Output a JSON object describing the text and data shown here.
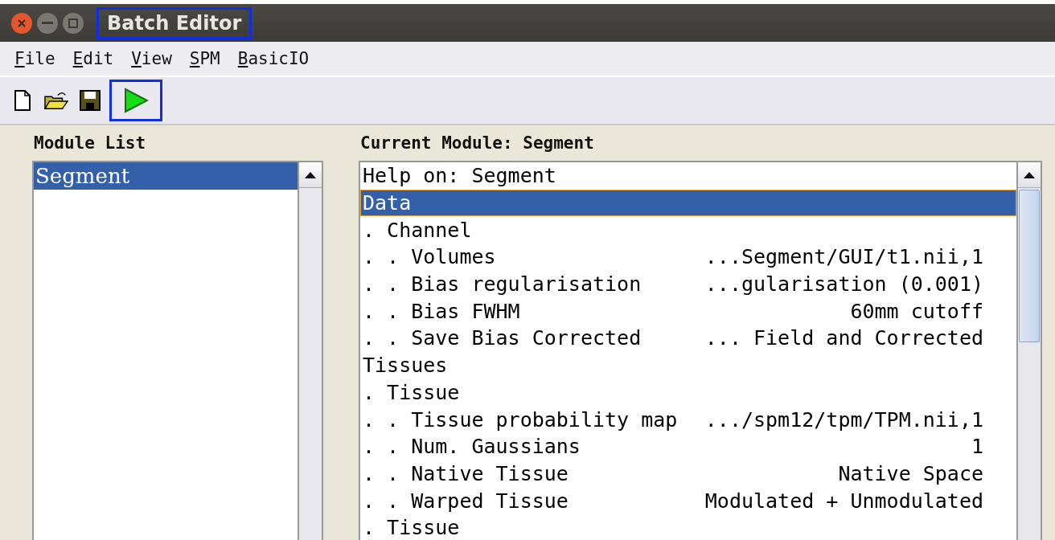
{
  "window": {
    "title": "Batch Editor",
    "highlighted": true
  },
  "menu": [
    {
      "label": "File"
    },
    {
      "label": "Edit"
    },
    {
      "label": "View"
    },
    {
      "label": "SPM"
    },
    {
      "label": "BasicIO"
    }
  ],
  "toolbar": [
    {
      "kind": "new",
      "highlighted": false
    },
    {
      "kind": "open",
      "highlighted": false
    },
    {
      "kind": "save",
      "highlighted": false
    },
    {
      "kind": "run",
      "highlighted": true
    }
  ],
  "module_list": {
    "heading": "Module List",
    "items": [
      {
        "label": "Segment",
        "selected": true
      }
    ]
  },
  "current_module": {
    "heading": "Current Module: Segment",
    "rows": [
      {
        "label": "Help on: Segment",
        "selected": false
      },
      {
        "label": "Data",
        "selected": true
      },
      {
        "label": ". Channel",
        "selected": false
      },
      {
        "label": ". . Volumes",
        "value": "...Segment/GUI/t1.nii,1",
        "selected": false
      },
      {
        "label": ". . Bias regularisation",
        "value": "...gularisation (0.001)",
        "selected": false
      },
      {
        "label": ". . Bias FWHM",
        "value": "60mm cutoff",
        "selected": false
      },
      {
        "label": ". . Save Bias Corrected",
        "value": "... Field and Corrected",
        "selected": false
      },
      {
        "label": "Tissues",
        "selected": false
      },
      {
        "label": ". Tissue",
        "selected": false
      },
      {
        "label": ". . Tissue probability map",
        "value": ".../spm12/tpm/TPM.nii,1",
        "selected": false
      },
      {
        "label": ". . Num. Gaussians",
        "value": "1",
        "selected": false
      },
      {
        "label": ". . Native Tissue",
        "value": "Native Space",
        "selected": false
      },
      {
        "label": ". . Warped Tissue",
        "value": "Modulated + Unmodulated",
        "selected": false
      },
      {
        "label": ". Tissue",
        "selected": false
      }
    ]
  }
}
